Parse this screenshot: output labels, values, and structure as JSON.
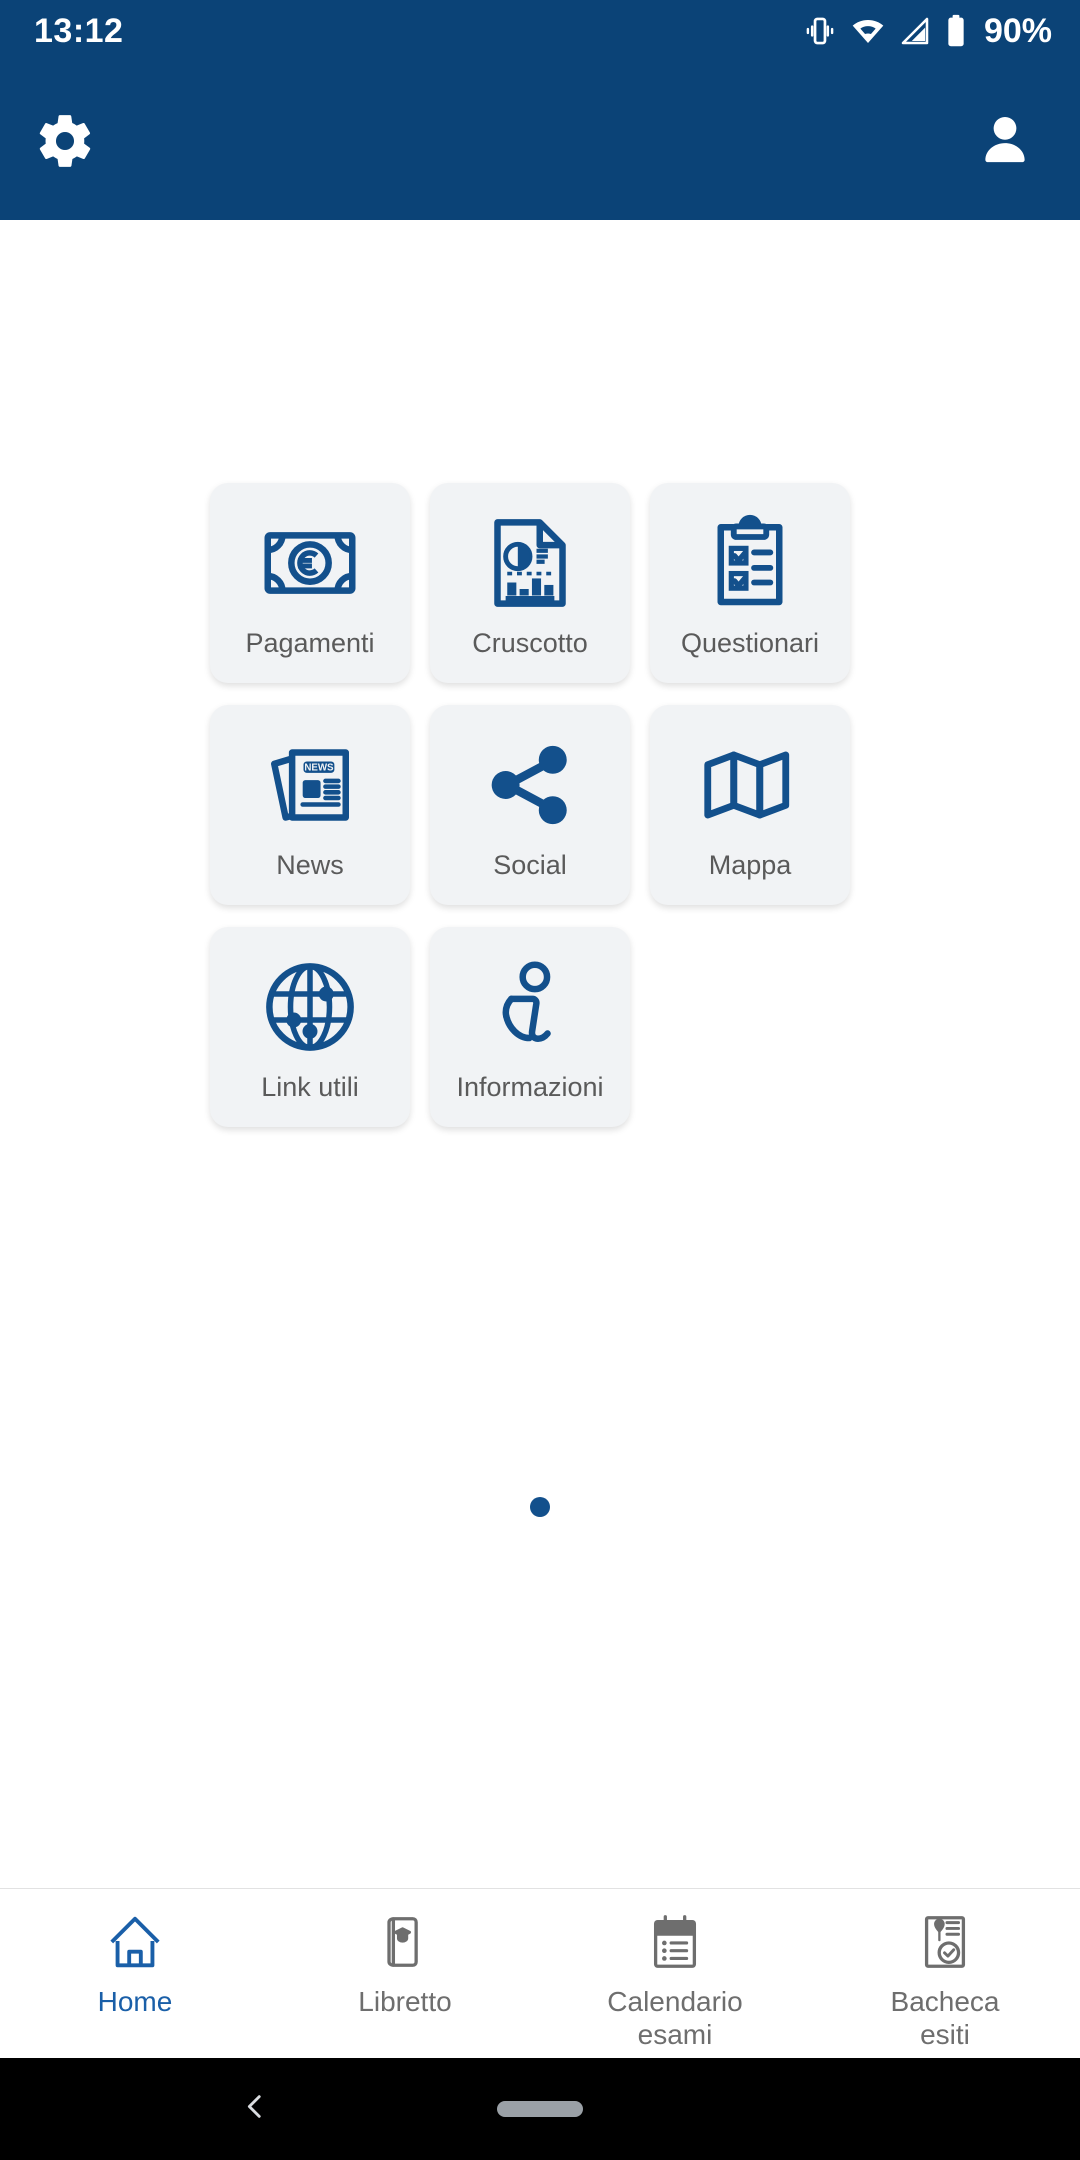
{
  "status_bar": {
    "time": "13:12",
    "battery_percent": "90%",
    "icons": [
      "vibrate-icon",
      "wifi-icon",
      "signal-icon",
      "battery-icon"
    ]
  },
  "app_bar": {
    "settings_icon": "gear-icon",
    "profile_icon": "person-icon"
  },
  "colors": {
    "brand_blue": "#0B4377",
    "icon_blue": "#13508C",
    "tile_bg": "#F1F3F5",
    "tile_label": "#5A5A5A",
    "tab_active": "#1A5FA8",
    "tab_inactive": "#6E6E6E"
  },
  "grid": {
    "tiles": [
      {
        "label": "Pagamenti",
        "icon": "banknote-euro-icon"
      },
      {
        "label": "Cruscotto",
        "icon": "report-chart-icon"
      },
      {
        "label": "Questionari",
        "icon": "clipboard-checklist-icon"
      },
      {
        "label": "News",
        "icon": "newspaper-icon"
      },
      {
        "label": "Social",
        "icon": "share-nodes-icon"
      },
      {
        "label": "Mappa",
        "icon": "folded-map-icon"
      },
      {
        "label": "Link utili",
        "icon": "globe-network-icon"
      },
      {
        "label": "Informazioni",
        "icon": "info-i-icon"
      }
    ]
  },
  "pager": {
    "page_count": 1,
    "active_page": 1
  },
  "tab_bar": {
    "tabs": [
      {
        "label": "Home",
        "icon": "home-icon",
        "active": true
      },
      {
        "label": "Libretto",
        "icon": "booklet-icon",
        "active": false
      },
      {
        "label": "Calendario\nesami",
        "icon": "calendar-icon",
        "active": false
      },
      {
        "label": "Bacheca\nesiti",
        "icon": "certificate-icon",
        "active": false
      }
    ]
  },
  "system_nav": {
    "back_icon": "chevron-left-icon",
    "home_pill": "home-pill"
  }
}
